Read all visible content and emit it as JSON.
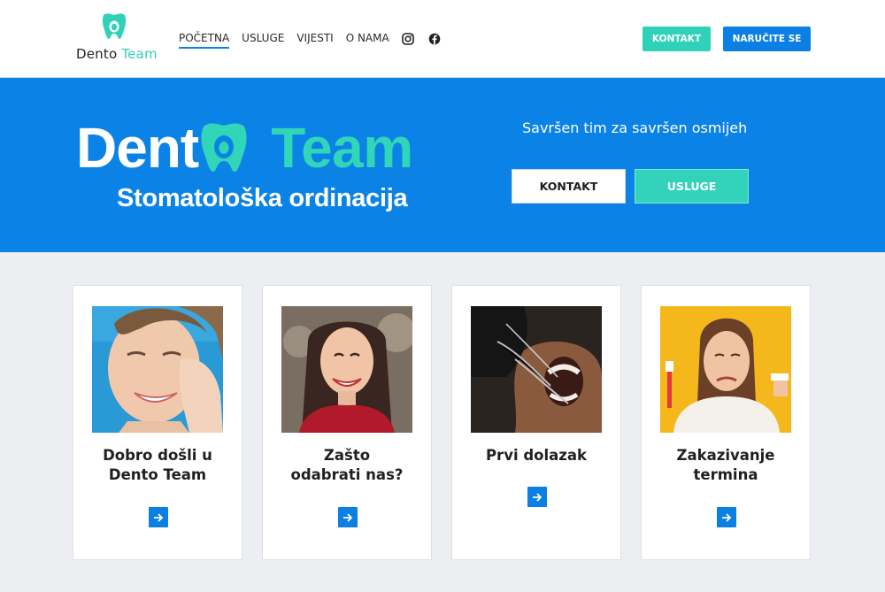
{
  "header": {
    "logo": {
      "word1": "Dento",
      "word2": "Team"
    },
    "nav": [
      {
        "label": "POČETNA",
        "active": true
      },
      {
        "label": "USLUGE",
        "active": false
      },
      {
        "label": "VIJESTI",
        "active": false
      },
      {
        "label": "O NAMA",
        "active": false
      }
    ],
    "social_icons": [
      "instagram-icon",
      "facebook-icon"
    ],
    "buttons": {
      "kontakt": "KONTAKT",
      "naruci": "NARUČITE SE"
    }
  },
  "hero": {
    "brand_word1": "Dent",
    "brand_word2": "Team",
    "subtitle": "Stomatološka ordinacija",
    "tagline": "Savršen tim za savršen osmijeh",
    "btn_kontakt": "KONTAKT",
    "btn_usluge": "USLUGE"
  },
  "cards": [
    {
      "title": "Dobro došli u Dento Team",
      "image": "woman-touching-cheek-photo"
    },
    {
      "title": "Zašto odabrati nas?",
      "image": "smiling-woman-photo"
    },
    {
      "title": "Prvi dolazak",
      "image": "dental-examination-photo"
    },
    {
      "title": "Zakazivanje termina",
      "image": "woman-with-toothbrush-photo"
    }
  ],
  "colors": {
    "primary_blue": "#0b83e6",
    "teal": "#2fd2b8",
    "background": "#eceef2",
    "white": "#ffffff"
  }
}
